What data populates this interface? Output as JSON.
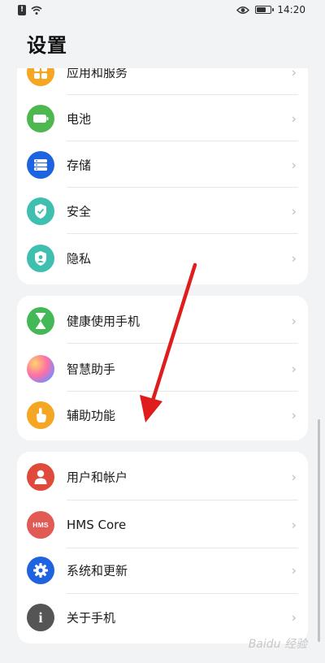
{
  "status_bar": {
    "time": "14:20",
    "battery_level": 0.7
  },
  "page": {
    "title": "设置"
  },
  "groups": [
    {
      "items": [
        {
          "label": "应用和服务",
          "icon": "apps-icon",
          "color": "#f5a623"
        },
        {
          "label": "电池",
          "icon": "battery-icon",
          "color": "#4cb84f"
        },
        {
          "label": "存储",
          "icon": "storage-icon",
          "color": "#1e63e0"
        },
        {
          "label": "安全",
          "icon": "shield-icon",
          "color": "#3fbfb0"
        },
        {
          "label": "隐私",
          "icon": "privacy-icon",
          "color": "#3fbfb0"
        }
      ]
    },
    {
      "items": [
        {
          "label": "健康使用手机",
          "icon": "hourglass-icon",
          "color": "#43b856"
        },
        {
          "label": "智慧助手",
          "icon": "assistant-icon",
          "color": "#d07ad8"
        },
        {
          "label": "辅助功能",
          "icon": "hand-icon",
          "color": "#f5a623"
        }
      ]
    },
    {
      "items": [
        {
          "label": "用户和帐户",
          "icon": "user-icon",
          "color": "#e04a3a"
        },
        {
          "label": "HMS Core",
          "icon": "hms-icon",
          "color": "#e25a54",
          "icon_text": "HMS"
        },
        {
          "label": "系统和更新",
          "icon": "gear-icon",
          "color": "#1e63e0"
        },
        {
          "label": "关于手机",
          "icon": "info-icon",
          "color": "#555555"
        }
      ]
    }
  ],
  "chevron": "›",
  "watermark": "Baidu 经验"
}
